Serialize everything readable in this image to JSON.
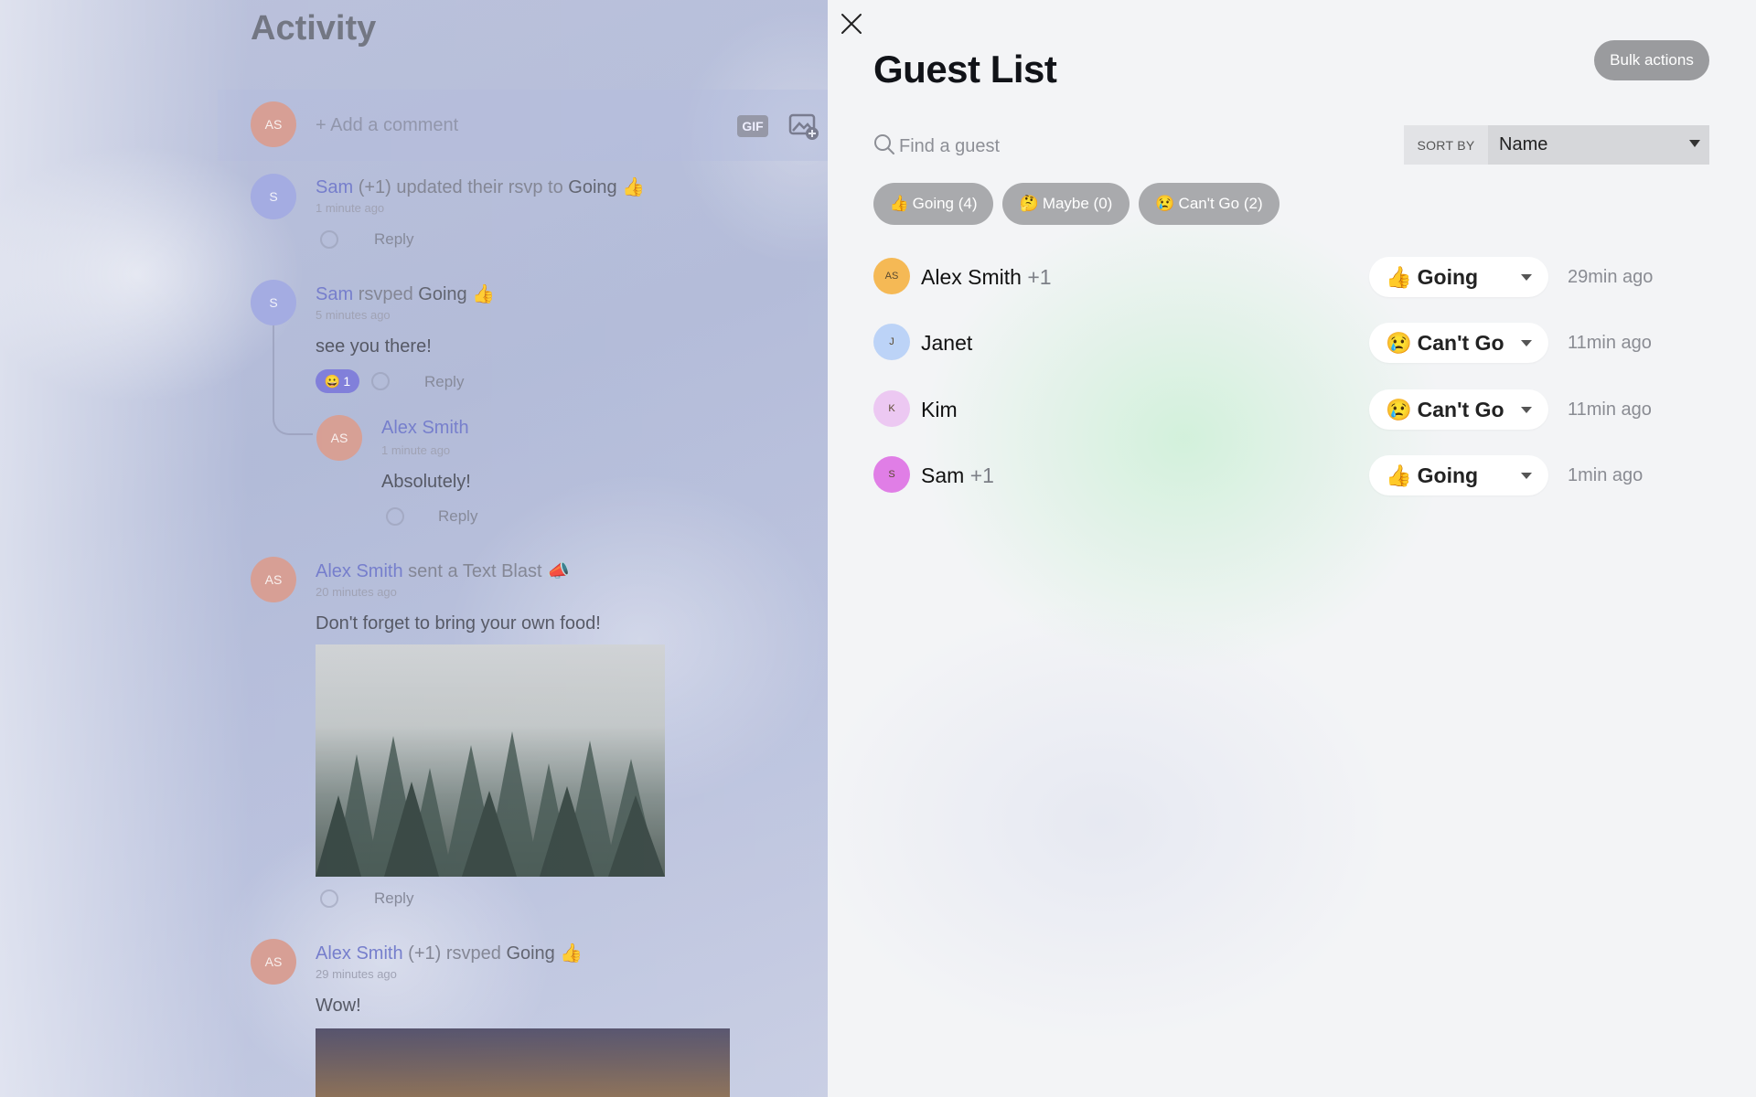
{
  "activity": {
    "title": "Activity",
    "composer": {
      "avatar_initials": "AS",
      "placeholder": "+ Add a comment",
      "gif_label": "GIF",
      "image_icon": "image-add-icon"
    },
    "items": [
      {
        "avatar": "S",
        "name": "Sam",
        "plus": "(+1)",
        "action": "updated their rsvp to",
        "status": "Going",
        "emoji": "👍",
        "time": "1 minute ago",
        "reply_label": "Reply"
      },
      {
        "avatar": "S",
        "name": "Sam",
        "action": "rsvped",
        "status": "Going",
        "emoji": "👍",
        "time": "5 minutes ago",
        "body": "see you there!",
        "reaction_emoji": "😀",
        "reaction_count": "1",
        "reply_label": "Reply",
        "reply": {
          "avatar": "AS",
          "name": "Alex Smith",
          "time": "1 minute ago",
          "body": "Absolutely!",
          "reply_label": "Reply"
        }
      },
      {
        "avatar": "AS",
        "name": "Alex Smith",
        "action": "sent a Text Blast",
        "emoji": "📣",
        "time": "20 minutes ago",
        "body": "Don't forget to bring your own food!",
        "reply_label": "Reply"
      },
      {
        "avatar": "AS",
        "name": "Alex Smith",
        "plus": "(+1)",
        "action": "rsvped",
        "status": "Going",
        "emoji": "👍",
        "time": "29 minutes ago",
        "body": "Wow!"
      }
    ]
  },
  "guest_list": {
    "close_icon": "close-icon",
    "title": "Guest List",
    "bulk_actions_label": "Bulk actions",
    "search_placeholder": "Find a guest",
    "sort_by_label": "SORT BY",
    "sort_value": "Name",
    "filters": [
      {
        "emoji": "👍",
        "label": "Going (4)"
      },
      {
        "emoji": "🤔",
        "label": "Maybe (0)"
      },
      {
        "emoji": "😢",
        "label": "Can't Go (2)"
      }
    ],
    "guests": [
      {
        "initials": "AS",
        "name": "Alex Smith",
        "plus": "+1",
        "status_emoji": "👍",
        "status": "Going",
        "time": "29min ago",
        "avatar_color": "#f5b955"
      },
      {
        "initials": "J",
        "name": "Janet",
        "plus": "",
        "status_emoji": "😢",
        "status": "Can't Go",
        "time": "11min ago",
        "avatar_color": "#bcd3f7"
      },
      {
        "initials": "K",
        "name": "Kim",
        "plus": "",
        "status_emoji": "😢",
        "status": "Can't Go",
        "time": "11min ago",
        "avatar_color": "#ecc8f2"
      },
      {
        "initials": "S",
        "name": "Sam",
        "plus": "+1",
        "status_emoji": "👍",
        "status": "Going",
        "time": "1min ago",
        "avatar_color": "#e07ee6"
      }
    ]
  }
}
